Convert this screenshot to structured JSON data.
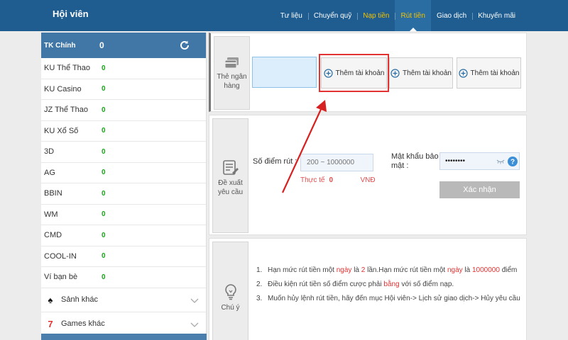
{
  "header": {
    "title": "Hội viên",
    "nav": [
      {
        "label": "Tư liệu",
        "state": "normal"
      },
      {
        "label": "Chuyển quỹ",
        "state": "normal"
      },
      {
        "label": "Nạp tiền",
        "state": "highlight"
      },
      {
        "label": "Rút tiền",
        "state": "active"
      },
      {
        "label": "Giao dịch",
        "state": "normal"
      },
      {
        "label": "Khuyến mãi",
        "state": "normal"
      }
    ]
  },
  "sidebar": {
    "main_account": {
      "name": "TK Chính",
      "value": "0"
    },
    "accounts": [
      {
        "name": "KU Thể Thao",
        "value": "0"
      },
      {
        "name": "KU Casino",
        "value": "0"
      },
      {
        "name": "JZ Thể Thao",
        "value": "0"
      },
      {
        "name": "KU Xổ Số",
        "value": "0"
      },
      {
        "name": "3D",
        "value": "0"
      },
      {
        "name": "AG",
        "value": "0"
      },
      {
        "name": "BBIN",
        "value": "0"
      },
      {
        "name": "WM",
        "value": "0"
      },
      {
        "name": "CMD",
        "value": "0"
      },
      {
        "name": "COOL-IN",
        "value": "0"
      },
      {
        "name": "Ví bạn bè",
        "value": "0"
      }
    ],
    "groups": [
      {
        "label": "Sảnh khác",
        "icon": "♠",
        "icon_color": "#111111"
      },
      {
        "label": "Games khác",
        "icon": "7",
        "icon_color": "#e23232"
      }
    ]
  },
  "bank_panel": {
    "label": "Thẻ ngân hàng",
    "add_buttons": [
      "Thêm tài khoản",
      "Thêm tài khoản",
      "Thêm tài khoản"
    ]
  },
  "withdraw_panel": {
    "label": "Đề xuất yêu cầu",
    "amount_label": "Số điểm rút :",
    "amount_placeholder": "200 ~ 1000000",
    "actual_label": "Thực tế",
    "actual_value": "0",
    "currency": "VNĐ",
    "password_label": "Mật khẩu bảo mật :",
    "password_mask": "••••••••",
    "submit_label": "Xác nhận"
  },
  "notes_panel": {
    "label": "Chú ý",
    "items": [
      {
        "index": "1.",
        "parts": [
          {
            "text": "Hạn mức rút tiền một "
          },
          {
            "text": "ngày",
            "red": true
          },
          {
            "text": " là "
          },
          {
            "text": "2",
            "red": true
          },
          {
            "text": " lần.Hạn mức rút tiền một "
          },
          {
            "text": "ngày",
            "red": true
          },
          {
            "text": " là "
          },
          {
            "text": "1000000",
            "red": true
          },
          {
            "text": " điểm"
          }
        ]
      },
      {
        "index": "2.",
        "parts": [
          {
            "text": "Điều kiện rút tiền số điểm cược phải "
          },
          {
            "text": "bằng",
            "red": true
          },
          {
            "text": " với số điểm nạp."
          }
        ]
      },
      {
        "index": "3.",
        "parts": [
          {
            "text": "Muốn hủy lệnh rút tiền, hãy đến mục Hội viên-> Lịch sử giao dịch-> Hủy yêu cầu"
          }
        ]
      }
    ]
  },
  "colors": {
    "header_bg": "#1f5d91",
    "active_tab": "#f2c200",
    "value_green": "#1aa31a",
    "highlight_red": "#e23232"
  }
}
